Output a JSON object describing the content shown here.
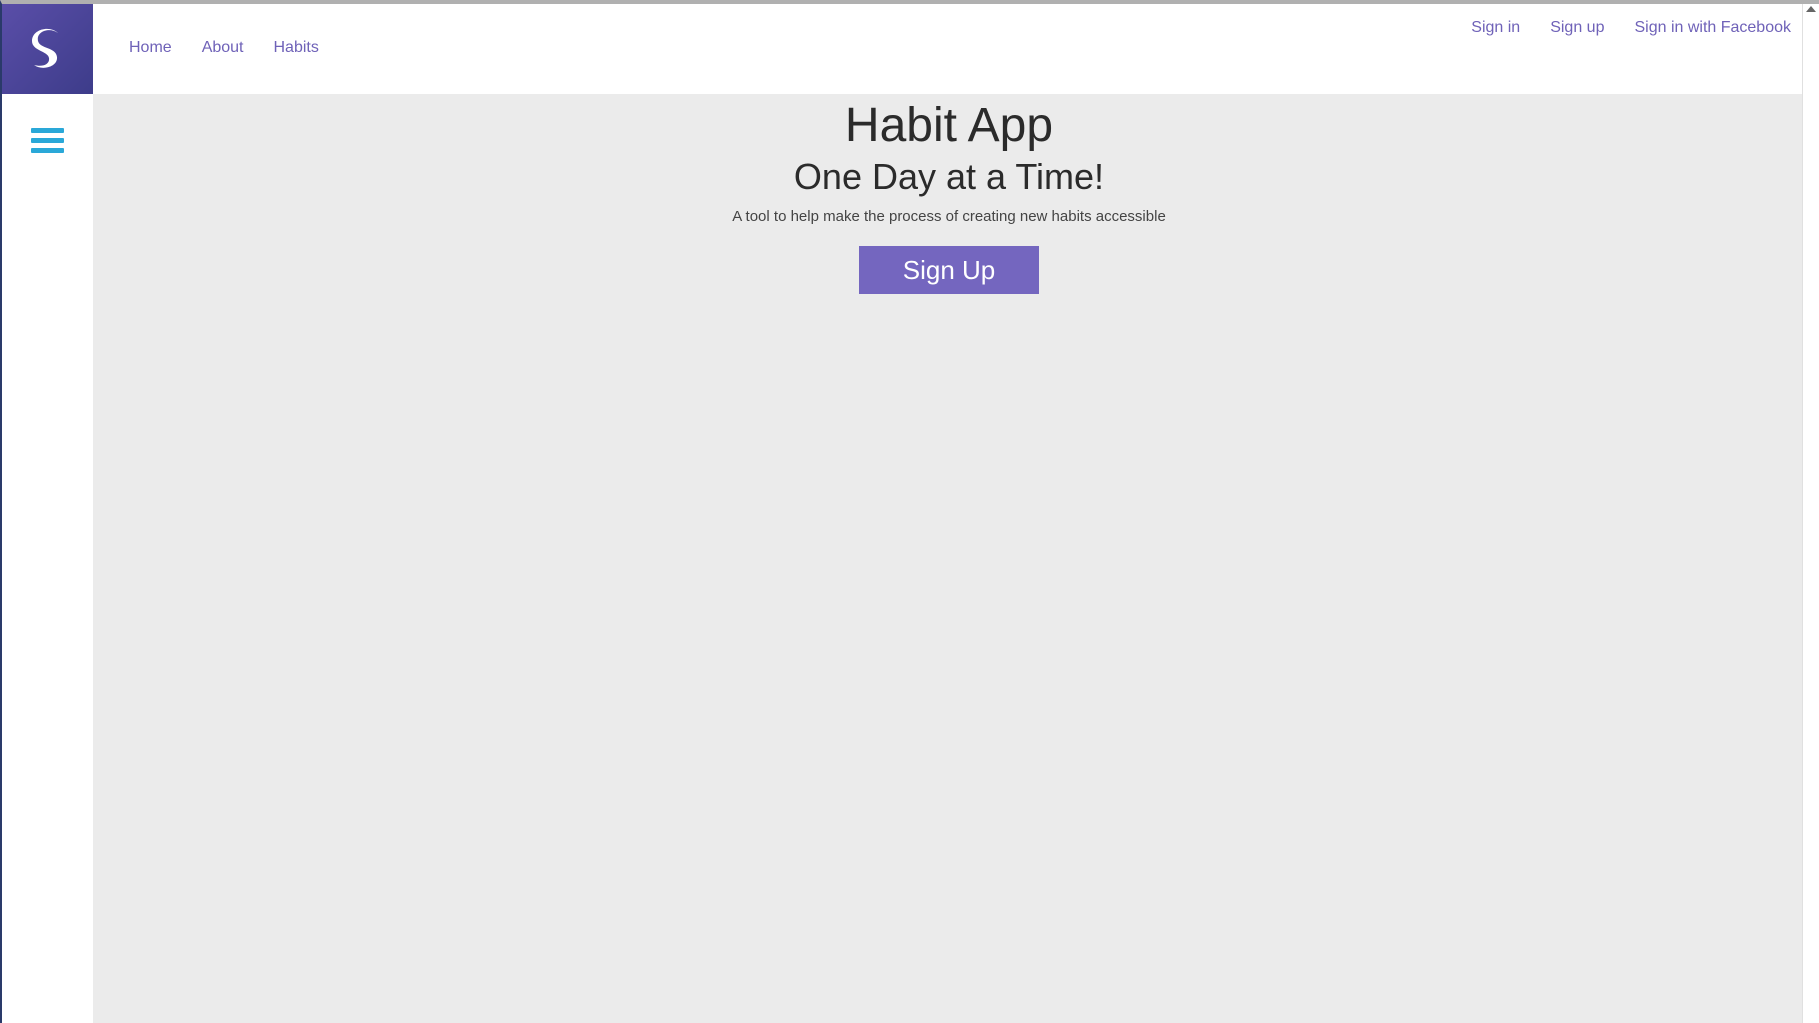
{
  "header": {
    "logo_icon": "s-swirl-logo",
    "nav_left": [
      {
        "label": "Home"
      },
      {
        "label": "About"
      },
      {
        "label": "Habits"
      }
    ],
    "nav_right": [
      {
        "label": "Sign in"
      },
      {
        "label": "Sign up"
      },
      {
        "label": "Sign in with Facebook"
      }
    ]
  },
  "sidebar": {
    "menu_icon": "hamburger-menu-icon"
  },
  "hero": {
    "title": "Habit App",
    "subtitle": "One Day at a Time!",
    "description": "A tool to help make the process of creating new habits accessible",
    "cta_label": "Sign Up"
  },
  "colors": {
    "brand": "#5a4ea8",
    "link": "#6f62b8",
    "button": "#7466bf",
    "menu_icon": "#2aa8d8",
    "main_bg": "#ebebeb"
  }
}
